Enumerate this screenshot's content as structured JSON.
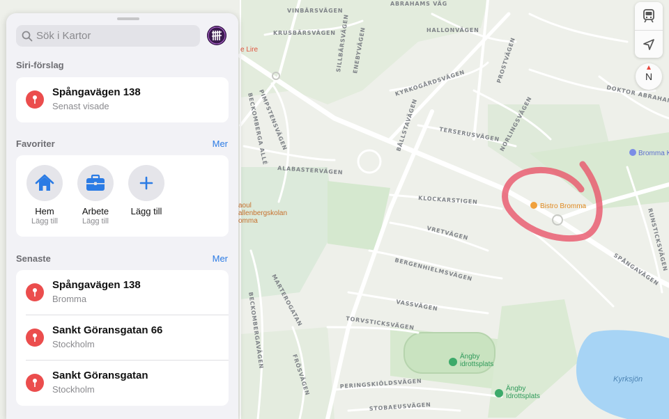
{
  "search": {
    "placeholder": "Sök i Kartor"
  },
  "siri": {
    "title": "Siri-förslag",
    "item": {
      "title": "Spångavägen 138",
      "subtitle": "Senast visade"
    }
  },
  "favorites": {
    "title": "Favoriter",
    "more": "Mer",
    "items": [
      {
        "label": "Hem",
        "sublabel": "Lägg till",
        "icon": "house-icon"
      },
      {
        "label": "Arbete",
        "sublabel": "Lägg till",
        "icon": "briefcase-icon"
      },
      {
        "label": "Lägg till",
        "sublabel": "",
        "icon": "plus-icon"
      }
    ]
  },
  "recent": {
    "title": "Senaste",
    "more": "Mer",
    "items": [
      {
        "title": "Spångavägen 138",
        "subtitle": "Bromma"
      },
      {
        "title": "Sankt Göransgatan 66",
        "subtitle": "Stockholm"
      },
      {
        "title": "Sankt Göransgatan",
        "subtitle": "Stockholm"
      }
    ]
  },
  "map": {
    "streets": [
      "VINBÄRSVÄGEN",
      "KRUSBÄRSVÄGEN",
      "HALLONVÄGEN",
      "ABRAHAMS VÄG",
      "SILLBÄRSVÄGEN",
      "ENEBYVÄGEN",
      "KYRKOGÅRDSVÄGEN",
      "PROSTVÄGEN",
      "DOKTOR ABRAHAMS VÄG",
      "PIMPSTENSVÄGEN",
      "BECKOMBERGA ALLÉ",
      "BÅLLSTAVÄGEN",
      "TERSERUSVÄGEN",
      "NORLINGSVÄGEN",
      "ALABASTERVÄGEN",
      "KLOCKARSTIGEN",
      "VRETVÄGEN",
      "BERGENHIELMSVÄGEN",
      "MARTEROGATAN",
      "BECKOMBERGAVÄGEN",
      "VASSVÄGEN",
      "TORVSTICKSVÄGEN",
      "FRÖSVÄGEN",
      "PERINGSKIÖLDSVÄGEN",
      "STOBAEUSVÄGEN",
      "SPÅNGAVÄGEN",
      "RUNSTICKSVÄGEN"
    ],
    "pois": {
      "bistro": "Bistro Bromma",
      "school_partial": "aoul\nallenbergskolan\nomma",
      "fire_partial": "e Lire",
      "bromma_k": "Bromma K",
      "sports_1": "Ängby\nidrottsplats",
      "sports_2": "Ängby\nIdrottsplats",
      "lake": "Kyrksjön"
    },
    "compass_label": "N"
  },
  "colors": {
    "accent": "#2b7be4",
    "pin": "#eb4d4d",
    "annotation": "#e8556a",
    "water": "#a7d4f5",
    "park": "#d7e9cf"
  }
}
